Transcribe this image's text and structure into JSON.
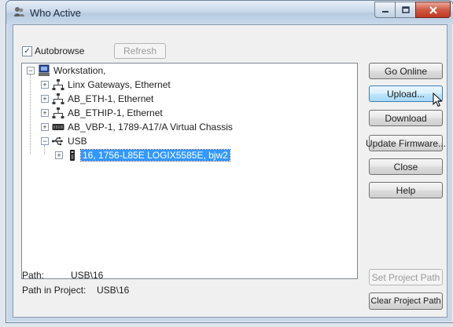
{
  "window": {
    "title": "Who Active"
  },
  "toolbar": {
    "autobrowse_label": "Autobrowse",
    "autobrowse_checked": true,
    "refresh_label": "Refresh"
  },
  "tree": {
    "root": "Workstation,",
    "items": [
      {
        "label": "Linx Gateways, Ethernet",
        "icon": "network-icon"
      },
      {
        "label": "AB_ETH-1, Ethernet",
        "icon": "network-icon"
      },
      {
        "label": "AB_ETHIP-1, Ethernet",
        "icon": "network-icon"
      },
      {
        "label": "AB_VBP-1, 1789-A17/A Virtual Chassis",
        "icon": "chassis-icon"
      },
      {
        "label": "USB",
        "icon": "usb-icon"
      }
    ],
    "usb_child": {
      "label": "16, 1756-L85E LOGIX5585E, bjw2",
      "icon": "controller-icon",
      "selected": true
    }
  },
  "buttons": {
    "go_online": "Go Online",
    "upload": "Upload...",
    "download": "Download",
    "update_firmware": "Update Firmware...",
    "close": "Close",
    "help": "Help",
    "set_project_path": "Set Project Path",
    "clear_project_path": "Clear Project Path"
  },
  "path": {
    "label": "Path:",
    "value": "USB\\16"
  },
  "path_in_project": {
    "label": "Path in Project:",
    "value": "USB\\16"
  },
  "colors": {
    "selection": "#3399ff",
    "title_close": "#c2381f"
  }
}
